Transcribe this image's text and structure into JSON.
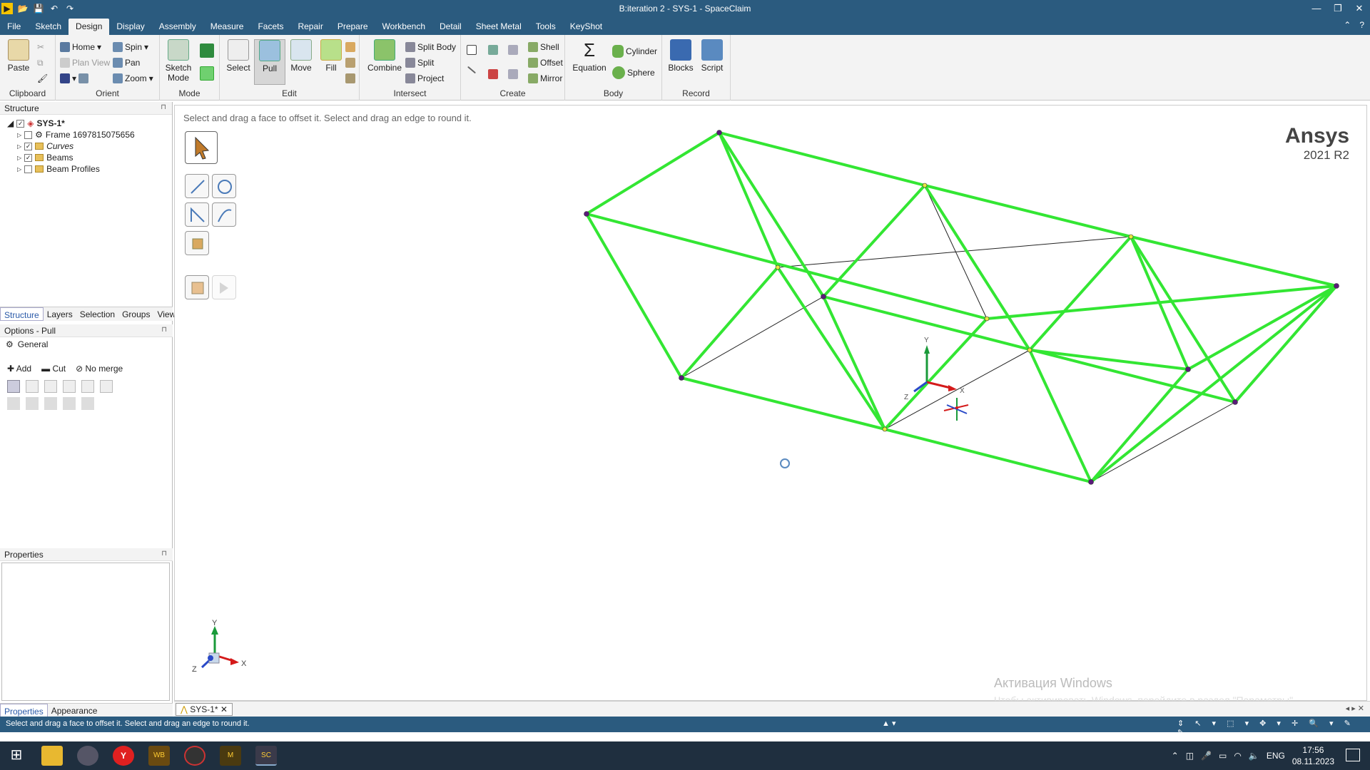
{
  "window": {
    "title": "B:iteration 2 - SYS-1 - SpaceClaim"
  },
  "menu": [
    "File",
    "Sketch",
    "Design",
    "Display",
    "Assembly",
    "Measure",
    "Facets",
    "Repair",
    "Prepare",
    "Workbench",
    "Detail",
    "Sheet Metal",
    "Tools",
    "KeyShot"
  ],
  "active_menu": "Design",
  "ribbon": {
    "clipboard": {
      "paste": "Paste",
      "label": "Clipboard"
    },
    "orient": {
      "home": "Home",
      "plan_view": "Plan View",
      "spin": "Spin",
      "pan": "Pan",
      "zoom": "Zoom",
      "label": "Orient"
    },
    "mode": {
      "sketch_mode": "Sketch Mode",
      "label": "Mode"
    },
    "edit": {
      "select": "Select",
      "pull": "Pull",
      "move": "Move",
      "fill": "Fill",
      "label": "Edit"
    },
    "intersect": {
      "combine": "Combine",
      "split_body": "Split Body",
      "split": "Split",
      "project": "Project",
      "label": "Intersect"
    },
    "create": {
      "shell": "Shell",
      "offset": "Offset",
      "mirror": "Mirror",
      "label": "Create"
    },
    "body": {
      "equation": "Equation",
      "cylinder": "Cylinder",
      "sphere": "Sphere",
      "label": "Body"
    },
    "record": {
      "blocks": "Blocks",
      "script": "Script",
      "label": "Record"
    }
  },
  "structure": {
    "header": "Structure",
    "root": "SYS-1*",
    "items": [
      {
        "label": "Frame 1697815075656",
        "checked": false
      },
      {
        "label": "Curves",
        "checked": true
      },
      {
        "label": "Beams",
        "checked": true
      },
      {
        "label": "Beam Profiles",
        "checked": false
      }
    ],
    "tabs": [
      "Structure",
      "Layers",
      "Selection",
      "Groups",
      "Views"
    ]
  },
  "options": {
    "header": "Options - Pull",
    "general": "General",
    "add": "Add",
    "cut": "Cut",
    "no_merge": "No merge"
  },
  "properties": {
    "header": "Properties",
    "tabs": [
      "Properties",
      "Appearance"
    ]
  },
  "viewport": {
    "hint": "Select and drag a face to offset it. Select and drag an edge to round it.",
    "brand": "Ansys",
    "version": "2021 R2",
    "watermark": "Активация Windows",
    "watermark_sub": "Чтобы активировать Windows, перейдите в раздел \"Параметры\".",
    "axis_x": "X",
    "axis_y": "Y",
    "axis_z": "Z",
    "line_color": "#33e633"
  },
  "doc_tab": "SYS-1*",
  "status": "Select and drag a face to offset it. Select and drag an edge to round it.",
  "taskbar": {
    "lang": "ENG",
    "time": "17:56",
    "date": "08.11.2023"
  }
}
